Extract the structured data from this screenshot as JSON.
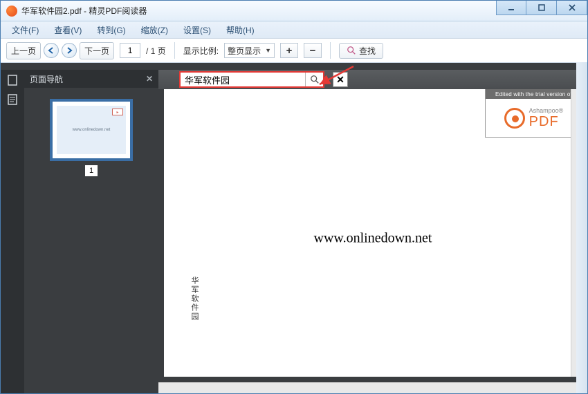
{
  "title": "华军软件园2.pdf - 精灵PDF阅读器",
  "menus": {
    "file": "文件(F)",
    "view": "查看(V)",
    "goto": "转到(G)",
    "zoom": "缩放(Z)",
    "settings": "设置(S)",
    "help": "帮助(H)"
  },
  "toolbar": {
    "prev": "上一页",
    "next": "下一页",
    "page_current": "1",
    "page_total": "/ 1 页",
    "zoom_label": "显示比例:",
    "zoom_value": "整页显示",
    "find": "查找"
  },
  "sidebar": {
    "title": "页面导航",
    "thumb_text": "www.onlinedown.net",
    "page_num": "1"
  },
  "findbar": {
    "value": "华军软件园"
  },
  "watermark": {
    "header": "Edited with the trial version of",
    "brand": "Ashampoo®",
    "product": "PDF"
  },
  "page": {
    "center": "www.onlinedown.net",
    "side": "华军软件园"
  }
}
